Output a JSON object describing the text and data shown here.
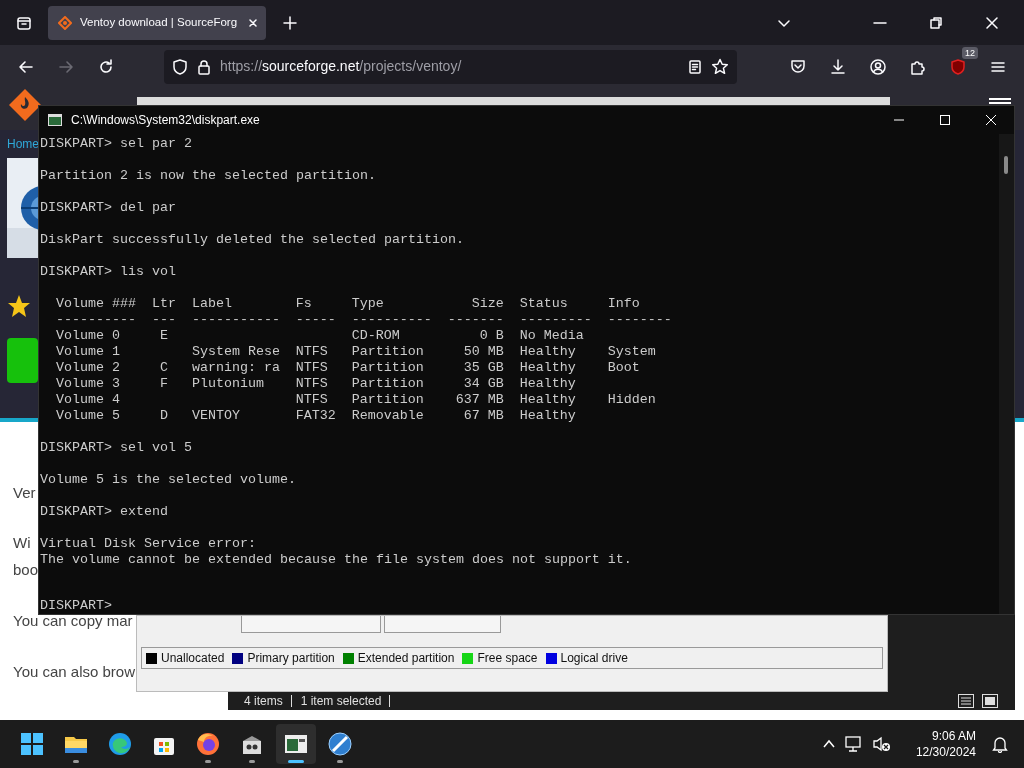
{
  "browser": {
    "tabs": [
      {
        "title": "Ventoy download | SourceForg",
        "selected": true
      }
    ],
    "nav_buttons": [
      {
        "kind": "back",
        "disabled": false
      },
      {
        "kind": "forward",
        "disabled": true
      },
      {
        "kind": "reload",
        "disabled": false
      }
    ],
    "url": {
      "scheme": "https://",
      "host": "sourceforge.net",
      "path": "/projects/ventoy/"
    },
    "toolbar": [
      {
        "kind": "pocket"
      },
      {
        "kind": "download"
      },
      {
        "kind": "account"
      },
      {
        "kind": "extensions"
      },
      {
        "kind": "blocker",
        "badge": "12"
      },
      {
        "kind": "menu"
      }
    ]
  },
  "web_page": {
    "breadcrumb": "Home",
    "fragments_upper": [
      "Ver",
      "Wi",
      "boo"
    ],
    "fragments_lower": [
      "You can copy mar",
      "You can also brow"
    ]
  },
  "console": {
    "title": "C:\\Windows\\System32\\diskpart.exe",
    "blocks": [
      {
        "kind": "text",
        "lines": [
          "DISKPART> sel par 2"
        ]
      },
      {
        "kind": "text",
        "lines": [
          "Partition 2 is now the selected partition."
        ]
      },
      {
        "kind": "text",
        "lines": [
          "DISKPART> del par"
        ]
      },
      {
        "kind": "text",
        "lines": [
          "DiskPart successfully deleted the selected partition."
        ]
      },
      {
        "kind": "text",
        "lines": [
          "DISKPART> lis vol"
        ]
      },
      {
        "kind": "table",
        "columns": [
          {
            "label": "Volume ###",
            "rule": "----------"
          },
          {
            "label": "Ltr",
            "rule": "---"
          },
          {
            "label": "Label",
            "rule": "-----------"
          },
          {
            "label": "Fs",
            "rule": "-----"
          },
          {
            "label": "Type",
            "rule": "----------"
          },
          {
            "label": "Size",
            "rule": "-------"
          },
          {
            "label": "Status",
            "rule": "---------"
          },
          {
            "label": "Info",
            "rule": "--------"
          }
        ],
        "rows": [
          [
            "Volume 0",
            "E",
            null,
            null,
            "CD-ROM",
            "0 B",
            "No Media",
            null
          ],
          [
            "Volume 1",
            null,
            "System Rese",
            "NTFS",
            "Partition",
            "50 MB",
            "Healthy",
            "System"
          ],
          [
            "Volume 2",
            "C",
            "warning: ra",
            "NTFS",
            "Partition",
            "35 GB",
            "Healthy",
            "Boot"
          ],
          [
            "Volume 3",
            "F",
            "Plutonium",
            "NTFS",
            "Partition",
            "34 GB",
            "Healthy",
            null
          ],
          [
            "Volume 4",
            null,
            null,
            "NTFS",
            "Partition",
            "637 MB",
            "Healthy",
            "Hidden"
          ],
          [
            "Volume 5",
            "D",
            "VENTOY",
            "FAT32",
            "Removable",
            "67 MB",
            "Healthy",
            null
          ]
        ]
      },
      {
        "kind": "text",
        "lines": [
          "DISKPART> sel vol 5"
        ]
      },
      {
        "kind": "text",
        "lines": [
          "Volume 5 is the selected volume."
        ]
      },
      {
        "kind": "text",
        "lines": [
          "DISKPART> extend"
        ]
      },
      {
        "kind": "text",
        "lines": [
          "Virtual Disk Service error:",
          "The volume cannot be extended because the file system does not support it."
        ]
      }
    ],
    "prompt": "DISKPART>"
  },
  "disk_management": {
    "legend": [
      {
        "label": "Unallocated",
        "color": "#000000"
      },
      {
        "label": "Primary partition",
        "color": "#000080"
      },
      {
        "label": "Extended partition",
        "color": "#008000"
      },
      {
        "label": "Free space",
        "color": "#16d616"
      },
      {
        "label": "Logical drive",
        "color": "#0000e0"
      }
    ]
  },
  "explorer_status": {
    "items": [
      "4 items",
      "1 item selected"
    ]
  },
  "taskbar": {
    "apps": [
      {
        "kind": "start",
        "running": false,
        "selected": false
      },
      {
        "kind": "folder",
        "running": true,
        "selected": false
      },
      {
        "kind": "edge",
        "running": false,
        "selected": false
      },
      {
        "kind": "store",
        "running": false,
        "selected": false
      },
      {
        "kind": "firefox",
        "running": true,
        "selected": false
      },
      {
        "kind": "installer",
        "running": true,
        "selected": false
      },
      {
        "kind": "console",
        "running": true,
        "selected": true
      },
      {
        "kind": "globe",
        "running": true,
        "selected": false
      }
    ],
    "time": "9:06 AM",
    "date": "12/30/2024"
  }
}
